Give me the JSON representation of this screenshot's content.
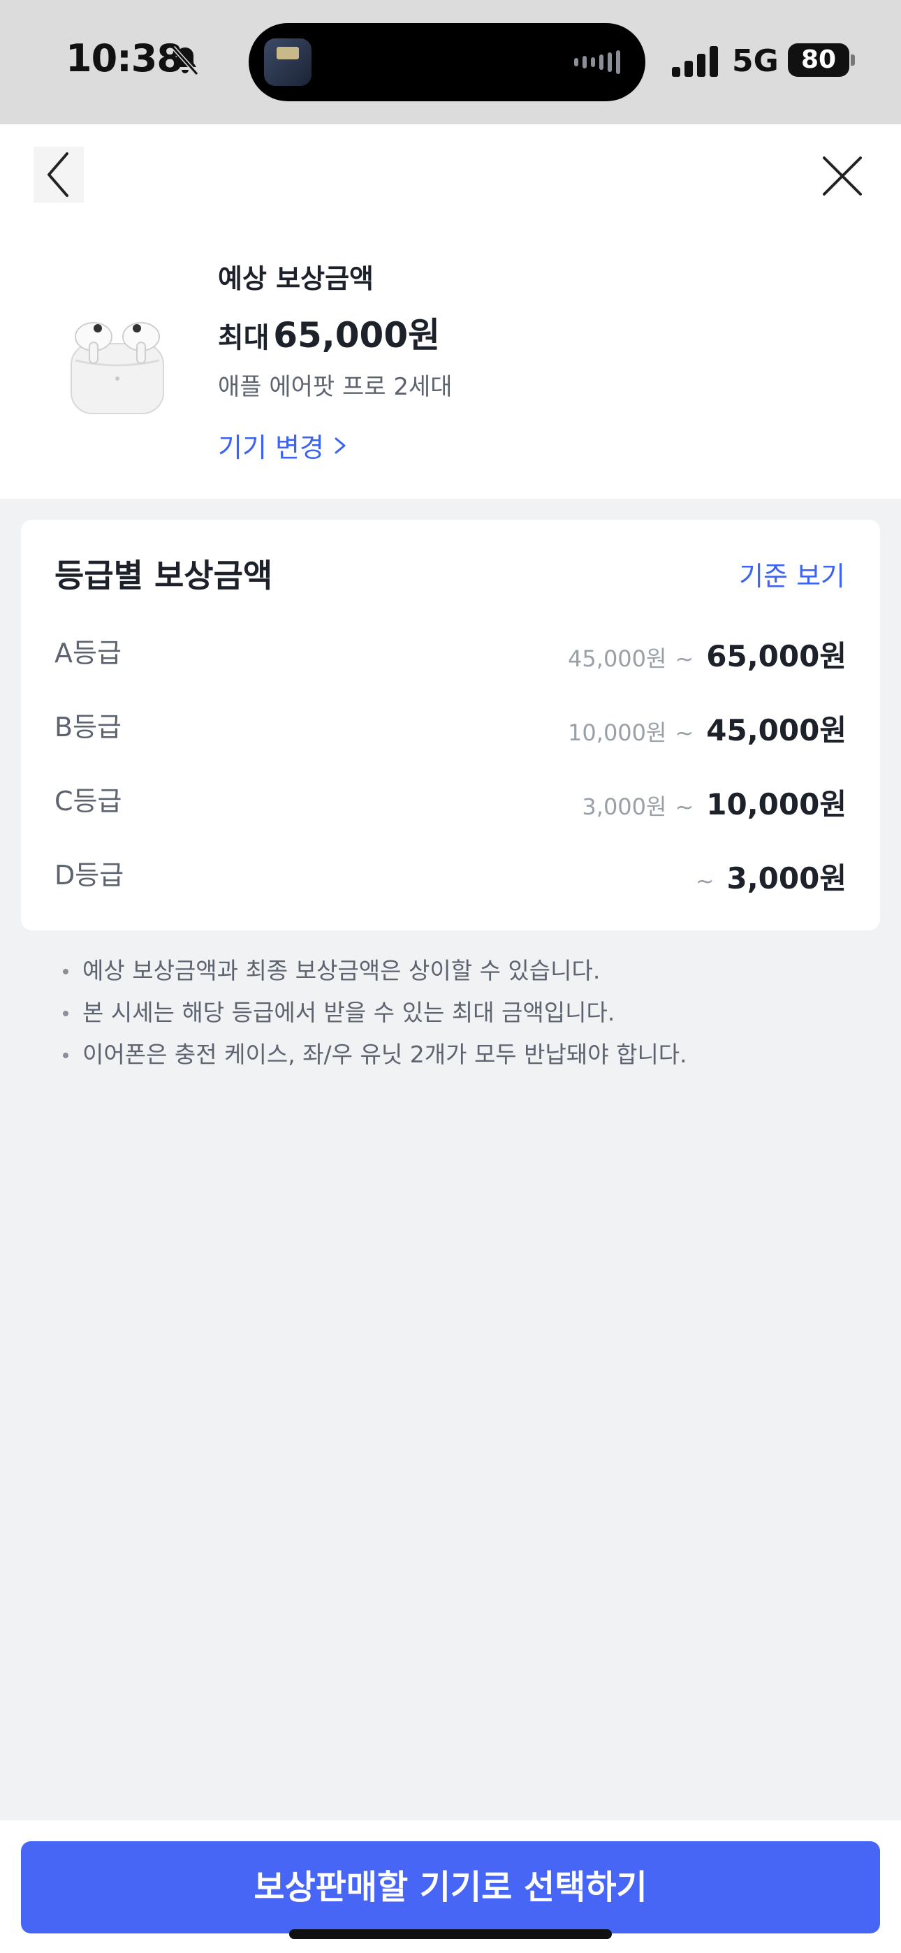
{
  "status_bar": {
    "time": "10:38",
    "network": "5G",
    "battery": "80"
  },
  "header": {
    "back_icon": "chevron-left-icon",
    "close_icon": "close-icon"
  },
  "product": {
    "estimate_label": "예상 보상금액",
    "max_prefix": "최대",
    "max_amount": "65,000원",
    "model": "애플 에어팟 프로 2세대",
    "change_link": "기기 변경"
  },
  "grades": {
    "title": "등급별 보상금액",
    "criteria_link": "기준 보기",
    "rows": [
      {
        "grade": "A등급",
        "min": "45,000원",
        "tilde": "~",
        "max": "65,000원"
      },
      {
        "grade": "B등급",
        "min": "10,000원",
        "tilde": "~",
        "max": "45,000원"
      },
      {
        "grade": "C등급",
        "min": "3,000원",
        "tilde": "~",
        "max": "10,000원"
      },
      {
        "grade": "D등급",
        "min": "",
        "tilde": "~",
        "max": "3,000원"
      }
    ]
  },
  "notes": [
    "예상 보상금액과 최종 보상금액은 상이할 수 있습니다.",
    "본 시세는 해당 등급에서 받을 수 있는 최대 금액입니다.",
    "이어폰은 충전 케이스, 좌/우 유닛 2개가 모두 반납돼야 합니다."
  ],
  "cta": {
    "label": "보상판매할 기기로 선택하기"
  },
  "colors": {
    "accent": "#3d63f2",
    "cta": "#4866f5",
    "background": "#f1f2f4"
  }
}
